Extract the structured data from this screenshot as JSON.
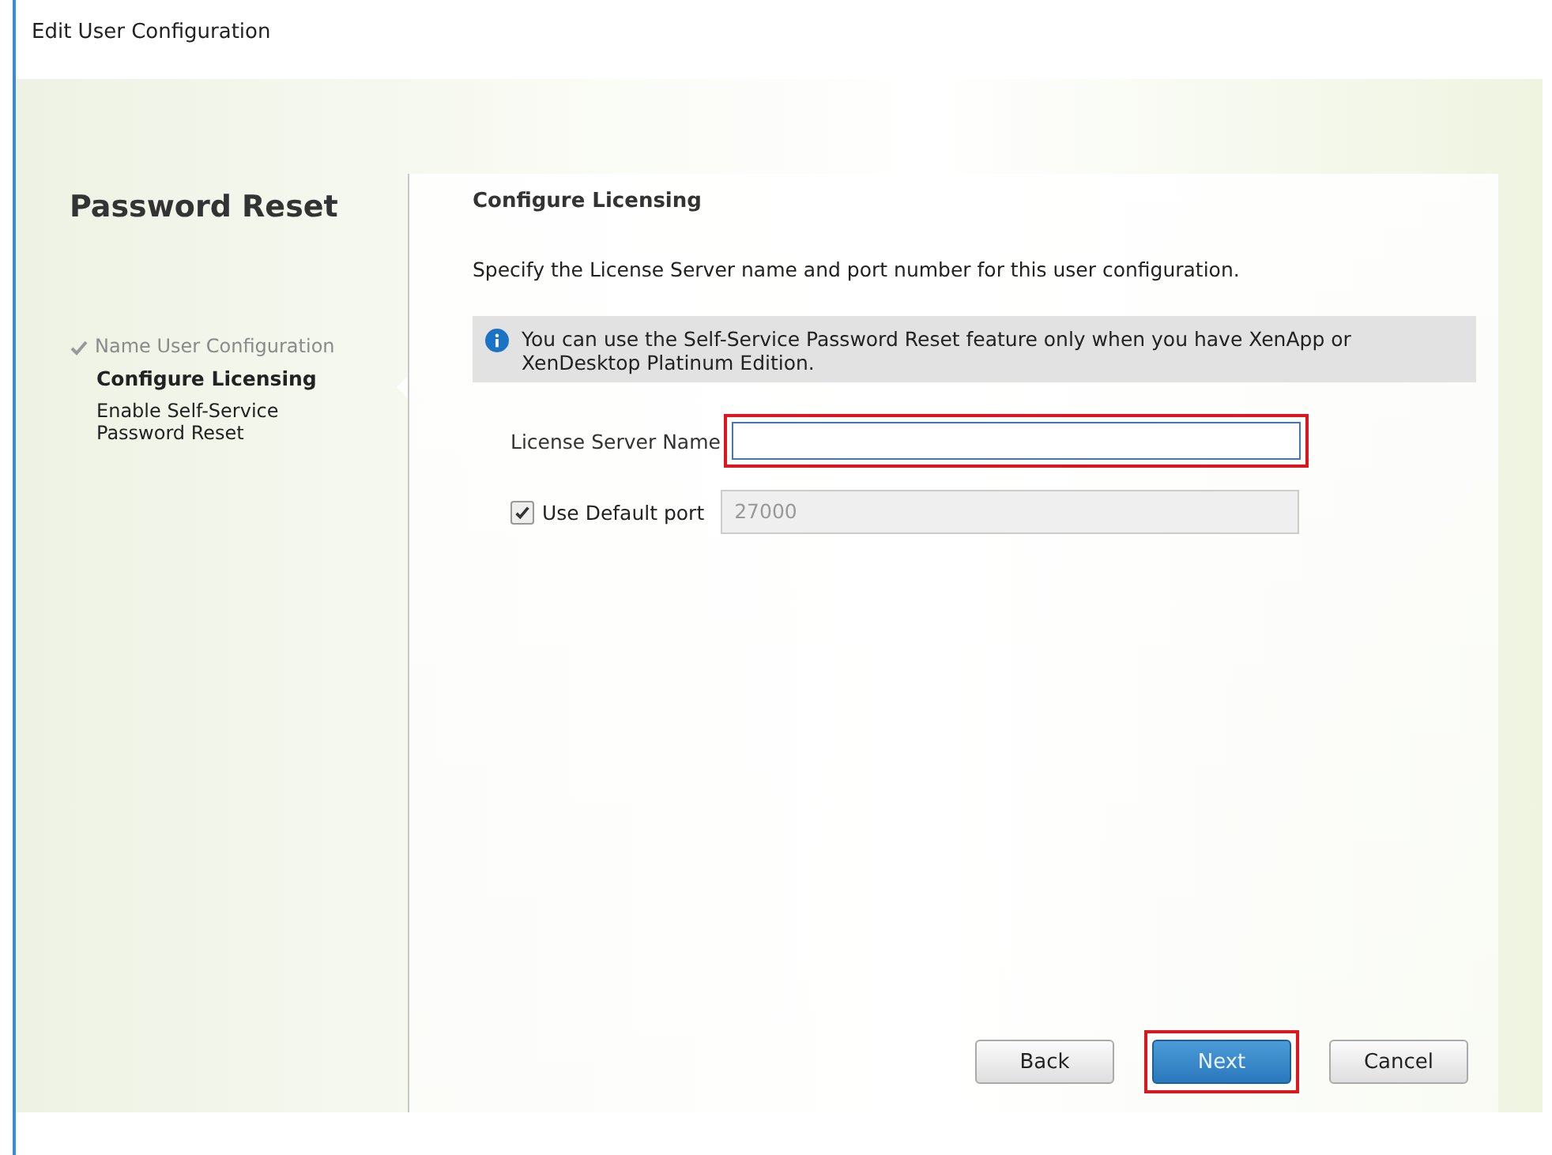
{
  "window": {
    "title": "Edit User Configuration"
  },
  "sidebar": {
    "title": "Password Reset",
    "steps": [
      {
        "label": "Name User Configuration",
        "completed": true,
        "selected": false
      },
      {
        "label": "Configure Licensing",
        "completed": false,
        "selected": true
      },
      {
        "label": "Enable Self-Service Password Reset",
        "completed": false,
        "selected": false
      }
    ]
  },
  "content": {
    "heading": "Configure Licensing",
    "description": "Specify the License Server name and port number for this user configuration.",
    "info": "You can use the Self-Service Password Reset feature only when you have XenApp or XenDesktop Platinum Edition.",
    "license_server": {
      "label": "License Server Name",
      "highlighted": true
    },
    "default_port": {
      "label": "Use Default port",
      "checked": true,
      "value": "27000",
      "disabled": true
    }
  },
  "buttons": [
    {
      "label": "Back",
      "primary": false,
      "highlighted": false
    },
    {
      "label": "Next",
      "primary": true,
      "highlighted": true
    },
    {
      "label": "Cancel",
      "primary": false,
      "highlighted": false
    }
  ]
}
